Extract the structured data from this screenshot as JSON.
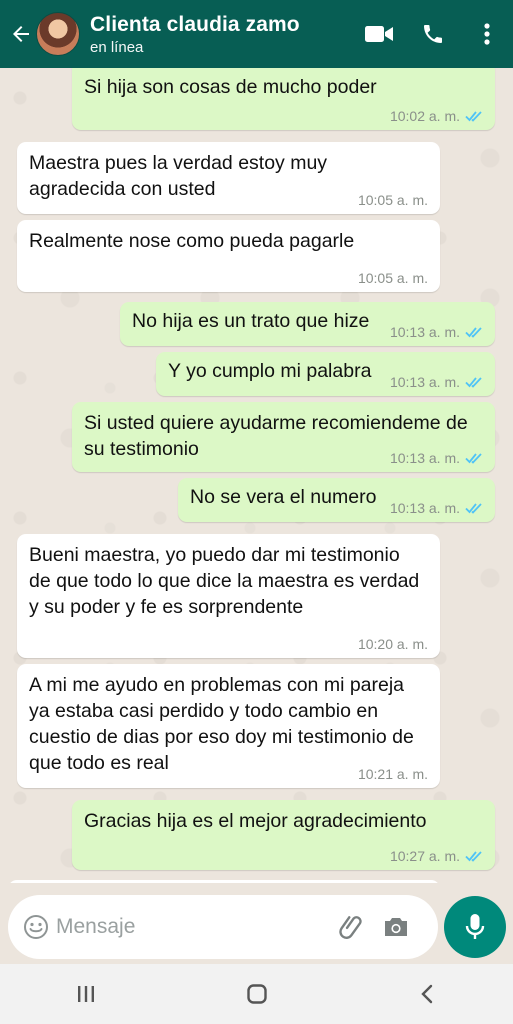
{
  "header": {
    "contact_name": "Clienta claudia zamo",
    "status": "en línea",
    "icons": [
      "back-arrow-icon",
      "avatar",
      "video-call-icon",
      "phone-icon",
      "more-vert-icon"
    ],
    "color": "#075e54"
  },
  "messages": [
    {
      "dir": "out",
      "text": "Si hija son cosas de mucho poder",
      "time": "10:02 a. m.",
      "read": true
    },
    {
      "dir": "in",
      "text": "Maestra pues la verdad estoy muy agradecida con usted",
      "time": "10:05 a. m."
    },
    {
      "dir": "in",
      "text": "Realmente nose como pueda pagarle",
      "time": "10:05 a. m."
    },
    {
      "dir": "out",
      "text": "No hija es un trato que hize",
      "time": "10:13 a. m.",
      "read": true
    },
    {
      "dir": "out",
      "text": "Y yo cumplo mi palabra",
      "time": "10:13 a. m.",
      "read": true
    },
    {
      "dir": "out",
      "text": "Si usted quiere ayudarme recomiendeme de su testimonio",
      "time": "10:13 a. m.",
      "read": true
    },
    {
      "dir": "out",
      "text": "No se vera el numero",
      "time": "10:13 a. m.",
      "read": true
    },
    {
      "dir": "in",
      "text": "Bueni maestra, yo puedo dar mi testimonio de que todo lo que dice la maestra es verdad y su poder y fe es sorprendente",
      "time": "10:20 a. m."
    },
    {
      "dir": "in",
      "text": "A mi me ayudo en problemas con mi pareja ya estaba casi perdido y todo cambio en cuestio  de dias por eso doy mi testimonio de que todo es real",
      "time": "10:21 a. m."
    },
    {
      "dir": "out",
      "text": "Gracias hija es el mejor agradecimiento",
      "time": "10:27 a. m.",
      "read": true
    }
  ],
  "composer": {
    "placeholder": "Mensaje",
    "icons": [
      "emoji-icon",
      "attach-icon",
      "camera-icon",
      "mic-icon"
    ]
  },
  "navbar": {
    "icons": [
      "recent-apps-icon",
      "home-icon",
      "back-icon"
    ]
  },
  "colors": {
    "outgoing_bubble": "#dcf8c6",
    "incoming_bubble": "#ffffff",
    "read_ticks": "#4fc3f7",
    "mic_button": "#00897b"
  }
}
